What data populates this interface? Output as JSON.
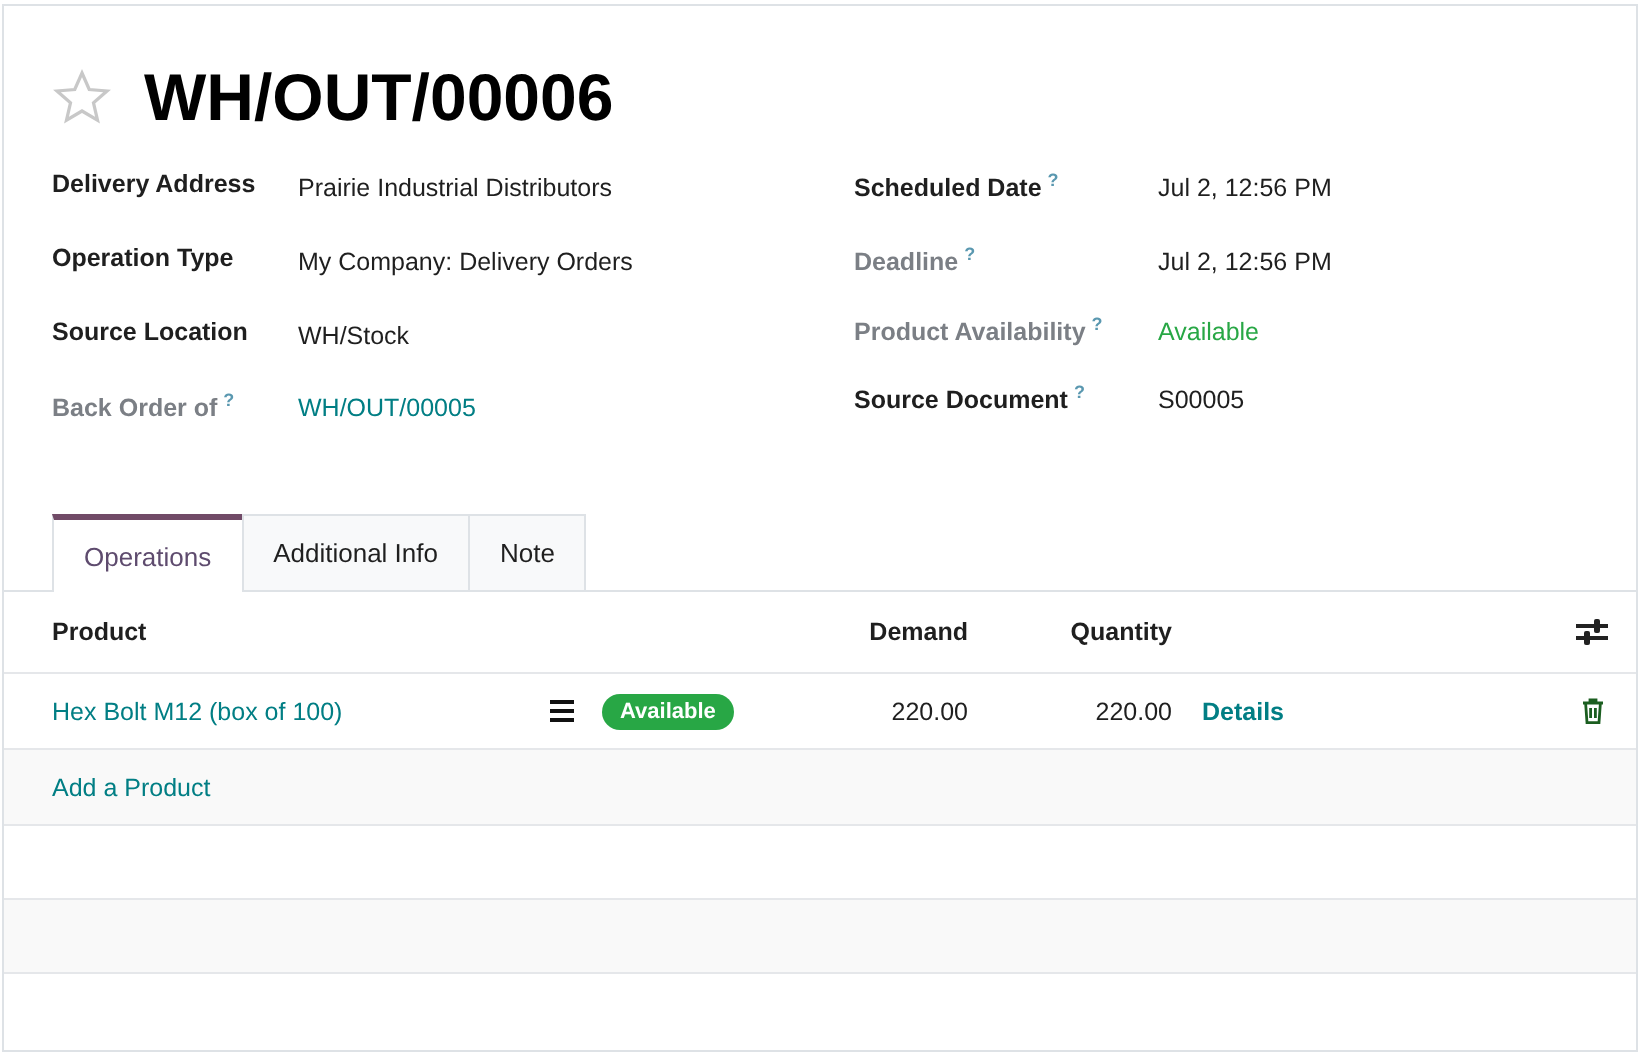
{
  "record": {
    "title": "WH/OUT/00006",
    "starred": false
  },
  "fields_left": [
    {
      "label": "Delivery Address",
      "muted": false,
      "value": "Prairie Industrial Distributors",
      "kind": "text"
    },
    {
      "label": "Operation Type",
      "muted": false,
      "value": "My Company: Delivery Orders",
      "kind": "text"
    },
    {
      "label": "Source Location",
      "muted": false,
      "value": "WH/Stock",
      "kind": "text"
    },
    {
      "label": "Back Order of",
      "help": "?",
      "muted": true,
      "value": "WH/OUT/00005",
      "kind": "link"
    }
  ],
  "fields_right": [
    {
      "label": "Scheduled Date",
      "help": "?",
      "muted": false,
      "value": "Jul 2, 12:56 PM",
      "kind": "text"
    },
    {
      "label": "Deadline",
      "help": "?",
      "muted": true,
      "value": "Jul 2, 12:56 PM",
      "kind": "text"
    },
    {
      "label": "Product Availability",
      "help": "?",
      "muted": true,
      "value": "Available",
      "kind": "success"
    },
    {
      "label": "Source Document",
      "help": "?",
      "muted": false,
      "value": "S00005",
      "kind": "text"
    }
  ],
  "tabs": [
    {
      "label": "Operations",
      "selected": true
    },
    {
      "label": "Additional Info",
      "selected": false
    },
    {
      "label": "Note",
      "selected": false
    }
  ],
  "table": {
    "columns": [
      "Product",
      "Demand",
      "Quantity"
    ],
    "rows": [
      {
        "product": "Hex Bolt M12 (box of 100)",
        "status": "Available",
        "demand": "220.00",
        "quantity": "220.00",
        "action": "Details"
      }
    ],
    "add_line": "Add a Product"
  }
}
